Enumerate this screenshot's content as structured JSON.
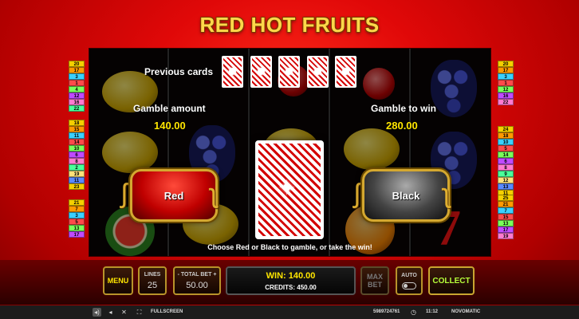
{
  "game": {
    "title": "RED HOT FRUITS"
  },
  "gamble": {
    "previous_cards_label": "Previous cards",
    "gamble_amount_label": "Gamble amount",
    "gamble_amount_value": "140.00",
    "gamble_to_win_label": "Gamble to win",
    "gamble_to_win_value": "280.00",
    "red_button": "Red",
    "black_button": "Black",
    "instruction": "Choose Red or Black to gamble, or take the win!",
    "previous_cards_count": 5
  },
  "paylines": {
    "left_top": [
      "20",
      "17",
      "3",
      "1",
      "4",
      "12",
      "16",
      "22"
    ],
    "left_mid": [
      "18",
      "15",
      "11",
      "14",
      "10",
      "6",
      "8",
      "2",
      "19",
      "11",
      "23"
    ],
    "left_bot": [
      "21",
      "7",
      "3",
      "5",
      "13",
      "17"
    ],
    "right_top": [
      "20",
      "17",
      "3",
      "1",
      "12",
      "16",
      "22"
    ],
    "right_mid": [
      "24",
      "18",
      "10",
      "5",
      "14",
      "6",
      "8",
      "9",
      "12",
      "13",
      "11"
    ],
    "right_bot": [
      "25",
      "21",
      "7",
      "15",
      "13",
      "17",
      "19"
    ],
    "colors": [
      "#f5d000",
      "#ff9a00",
      "#3ad0ff",
      "#ff4a4a",
      "#7aff5a",
      "#c04aff",
      "#ff7ad0",
      "#4aff9a",
      "#ffe27a",
      "#5a8aff"
    ]
  },
  "controls": {
    "menu": "MENU",
    "lines_label": "LINES",
    "lines_value": "25",
    "total_bet_label": "- TOTAL BET +",
    "total_bet_value": "50.00",
    "win_text": "WIN: 140.00",
    "credits_text": "CREDITS: 450.00",
    "max_bet_line1": "MAX",
    "max_bet_line2": "BET",
    "auto": "AUTO",
    "collect": "COLLECT"
  },
  "statusbar": {
    "fullscreen": "FULLSCREEN",
    "session_id": "5989724761",
    "time": "11:12",
    "brand": "NOVOMATIC"
  }
}
